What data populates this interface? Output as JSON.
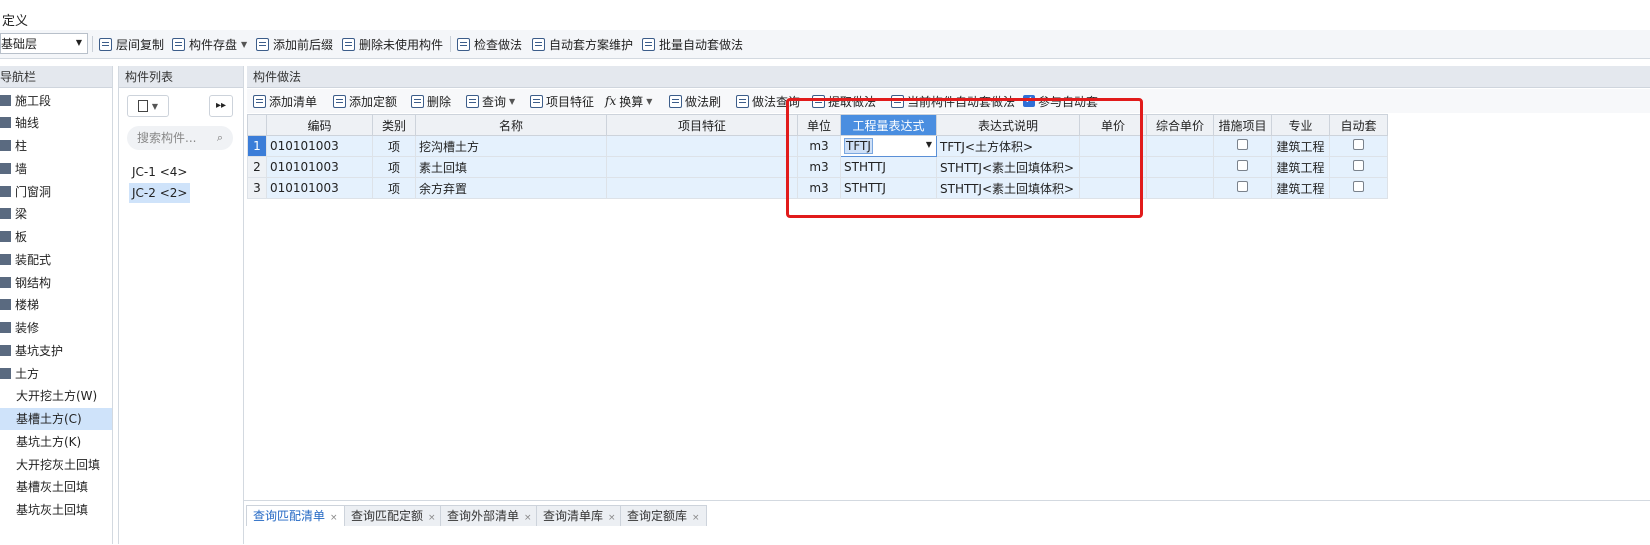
{
  "title": "定义",
  "toolbar": {
    "floor_select": "基础层",
    "items": [
      "层间复制",
      "构件存盘",
      "添加前后缀",
      "删除未使用构件",
      "检查做法",
      "自动套方案维护",
      "批量自动套做法"
    ]
  },
  "nav": {
    "header": "导航栏",
    "items": [
      "施工段",
      "轴线",
      "柱",
      "墙",
      "门窗洞",
      "梁",
      "板",
      "装配式",
      "钢结构",
      "楼梯",
      "装修",
      "基坑支护",
      "土方"
    ],
    "subitems": [
      "大开挖土方(W)",
      "基槽土方(C)",
      "基坑土方(K)",
      "大开挖灰土回填",
      "基槽灰土回填",
      "基坑灰土回填"
    ],
    "selected_subitem": "基槽土方(C)"
  },
  "complist": {
    "header": "构件列表",
    "search_placeholder": "搜索构件...",
    "items": [
      "JC-1 <4>",
      "JC-2 <2>"
    ],
    "selected": "JC-2 <2>"
  },
  "method": {
    "header": "构件做法",
    "tools": [
      "添加清单",
      "添加定额",
      "删除",
      "查询",
      "项目特征",
      "换算",
      "做法刷",
      "做法查询",
      "提取做法",
      "当前构件自动套做法",
      "参与自动套"
    ],
    "participate_auto_checked": true,
    "columns": [
      "编码",
      "类别",
      "名称",
      "项目特征",
      "单位",
      "工程量表达式",
      "表达式说明",
      "单价",
      "综合单价",
      "措施项目",
      "专业",
      "自动套"
    ],
    "rows": [
      {
        "num": "1",
        "code": "010101003",
        "type": "项",
        "name": "挖沟槽土方",
        "feature": "",
        "unit": "m3",
        "expr": "TFTJ",
        "expr_desc": "TFTJ<土方体积>",
        "price": "",
        "total": "",
        "major": "建筑工程"
      },
      {
        "num": "2",
        "code": "010101003",
        "type": "项",
        "name": "素土回填",
        "feature": "",
        "unit": "m3",
        "expr": "STHTTJ",
        "expr_desc": "STHTTJ<素土回填体积>",
        "price": "",
        "total": "",
        "major": "建筑工程"
      },
      {
        "num": "3",
        "code": "010101003",
        "type": "项",
        "name": "余方弃置",
        "feature": "",
        "unit": "m3",
        "expr": "STHTTJ",
        "expr_desc": "STHTTJ<素土回填体积>",
        "price": "",
        "total": "",
        "major": "建筑工程"
      }
    ]
  },
  "bottom_tabs": [
    "查询匹配清单",
    "查询匹配定额",
    "查询外部清单",
    "查询清单库",
    "查询定额库"
  ],
  "colors": {
    "highlight": "#e11b1b",
    "accent": "#4a8ee0",
    "row_bg": "#e5f1fd"
  }
}
